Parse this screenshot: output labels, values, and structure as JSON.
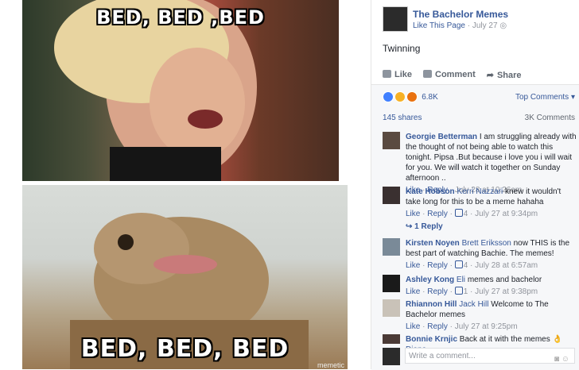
{
  "memes": {
    "top_caption": "BED, BED ,BED",
    "bottom_caption": "BED, BED, BED",
    "watermark": "memetic"
  },
  "post": {
    "page_name": "The Bachelor Memes",
    "like_page": "Like This Page",
    "date": "July 27",
    "text": "Twinning",
    "actions": [
      "Like",
      "Comment",
      "Share"
    ],
    "reactions_count": "6.8K",
    "top_comments": "Top Comments",
    "shares": "145 shares",
    "comments_count": "3K Comments",
    "reaction_colors": [
      "#4080ff",
      "#f7b125",
      "#e9710f"
    ]
  },
  "comments": [
    {
      "name": "Georgie Betterman",
      "mention": "",
      "text": "I am struggling already with the thought of not being able to watch this tonight. Pipsa .But because i love you i will wait for you. We will watch it together on Sunday afternoon ..",
      "meta": "July 28 at 10:26am",
      "likes": ""
    },
    {
      "name": "Kate Hobson",
      "mention": "Kerri Nazzari",
      "text": "knew it wouldn't take long for this to be a meme hahaha",
      "meta": "July 27 at 9:34pm",
      "likes": "4"
    },
    {
      "name": "Kirsten Noyen",
      "mention": "Brett Eriksson",
      "text": "now THIS is the best part of watching Bachie. The memes!",
      "meta": "July 28 at 6:57am",
      "likes": "4"
    },
    {
      "name": "Ashley Kong",
      "mention": "Eli",
      "text": "memes and bachelor",
      "meta": "July 27 at 9:38pm",
      "likes": "1"
    },
    {
      "name": "Rhiannon Hill",
      "mention": "Jack Hill",
      "text": "Welcome to The Bachelor memes",
      "meta": "July 27 at 9:25pm",
      "likes": ""
    },
    {
      "name": "Bonnie Krnjic",
      "mention": "",
      "text": "Back at it with the memes",
      "mention2": "Diana",
      "meta": "",
      "likes": ""
    }
  ],
  "reply_count": "1 Reply",
  "like_label": "Like",
  "reply_label": "Reply",
  "write_placeholder": "Write a comment..."
}
